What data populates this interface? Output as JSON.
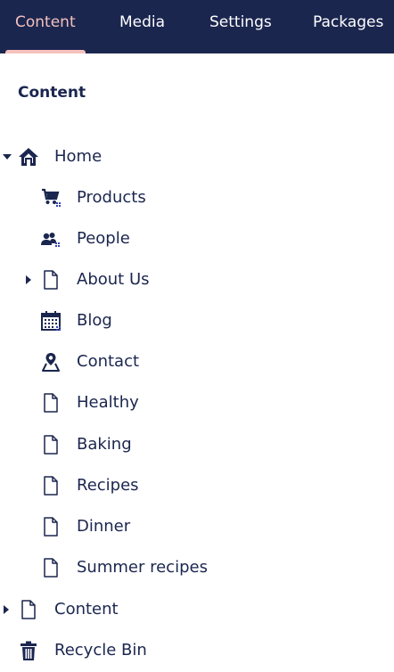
{
  "nav": {
    "tabs": [
      {
        "label": "Content",
        "active": true
      },
      {
        "label": "Media"
      },
      {
        "label": "Settings"
      },
      {
        "label": "Packages"
      }
    ]
  },
  "tree": {
    "header": "Content",
    "nodes": [
      {
        "label": "Home",
        "icon": "home-icon",
        "caret": "down"
      },
      {
        "label": "Products",
        "icon": "shopping-cart-icon"
      },
      {
        "label": "People",
        "icon": "users-icon"
      },
      {
        "label": "About Us",
        "icon": "document-icon",
        "caret": "right"
      },
      {
        "label": "Blog",
        "icon": "calendar-icon"
      },
      {
        "label": "Contact",
        "icon": "map-pin-icon"
      },
      {
        "label": "Healthy",
        "icon": "document-icon"
      },
      {
        "label": "Baking",
        "icon": "document-icon"
      },
      {
        "label": "Recipes",
        "icon": "document-icon"
      },
      {
        "label": "Dinner",
        "icon": "document-icon"
      },
      {
        "label": "Summer recipes",
        "icon": "document-icon"
      },
      {
        "label": "Content",
        "icon": "document-icon",
        "caret": "right"
      },
      {
        "label": "Recycle Bin",
        "icon": "trash-icon"
      }
    ]
  },
  "colors": {
    "nav_bg": "#1b264f",
    "active_tab": "#f5c1bc",
    "text": "#1b264f",
    "accent_blue": "#3544b1"
  }
}
